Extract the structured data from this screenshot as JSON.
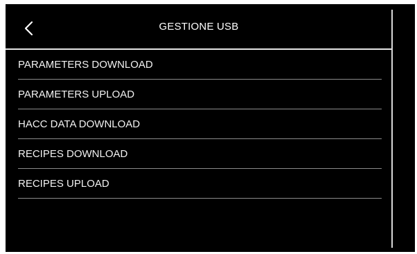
{
  "header": {
    "title": "GESTIONE USB",
    "back_icon": "chevron-left-icon"
  },
  "menu": {
    "items": [
      {
        "label": "PARAMETERS DOWNLOAD"
      },
      {
        "label": "PARAMETERS UPLOAD"
      },
      {
        "label": "HACC DATA DOWNLOAD"
      },
      {
        "label": "RECIPES DOWNLOAD"
      },
      {
        "label": "RECIPES UPLOAD"
      }
    ]
  },
  "colors": {
    "background": "#000000",
    "text": "#ffffff",
    "divider": "#8c8c8c"
  }
}
